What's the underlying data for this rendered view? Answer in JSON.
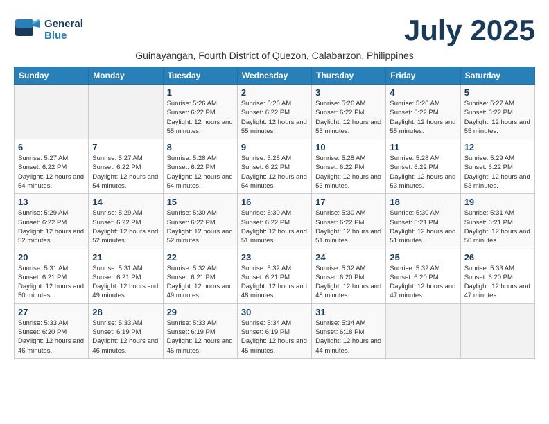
{
  "header": {
    "logo_line1": "General",
    "logo_line2": "Blue",
    "month_title": "July 2025",
    "subtitle": "Guinayangan, Fourth District of Quezon, Calabarzon, Philippines"
  },
  "weekdays": [
    "Sunday",
    "Monday",
    "Tuesday",
    "Wednesday",
    "Thursday",
    "Friday",
    "Saturday"
  ],
  "weeks": [
    [
      {
        "day": "",
        "info": ""
      },
      {
        "day": "",
        "info": ""
      },
      {
        "day": "1",
        "info": "Sunrise: 5:26 AM\nSunset: 6:22 PM\nDaylight: 12 hours and 55 minutes."
      },
      {
        "day": "2",
        "info": "Sunrise: 5:26 AM\nSunset: 6:22 PM\nDaylight: 12 hours and 55 minutes."
      },
      {
        "day": "3",
        "info": "Sunrise: 5:26 AM\nSunset: 6:22 PM\nDaylight: 12 hours and 55 minutes."
      },
      {
        "day": "4",
        "info": "Sunrise: 5:26 AM\nSunset: 6:22 PM\nDaylight: 12 hours and 55 minutes."
      },
      {
        "day": "5",
        "info": "Sunrise: 5:27 AM\nSunset: 6:22 PM\nDaylight: 12 hours and 55 minutes."
      }
    ],
    [
      {
        "day": "6",
        "info": "Sunrise: 5:27 AM\nSunset: 6:22 PM\nDaylight: 12 hours and 54 minutes."
      },
      {
        "day": "7",
        "info": "Sunrise: 5:27 AM\nSunset: 6:22 PM\nDaylight: 12 hours and 54 minutes."
      },
      {
        "day": "8",
        "info": "Sunrise: 5:28 AM\nSunset: 6:22 PM\nDaylight: 12 hours and 54 minutes."
      },
      {
        "day": "9",
        "info": "Sunrise: 5:28 AM\nSunset: 6:22 PM\nDaylight: 12 hours and 54 minutes."
      },
      {
        "day": "10",
        "info": "Sunrise: 5:28 AM\nSunset: 6:22 PM\nDaylight: 12 hours and 53 minutes."
      },
      {
        "day": "11",
        "info": "Sunrise: 5:28 AM\nSunset: 6:22 PM\nDaylight: 12 hours and 53 minutes."
      },
      {
        "day": "12",
        "info": "Sunrise: 5:29 AM\nSunset: 6:22 PM\nDaylight: 12 hours and 53 minutes."
      }
    ],
    [
      {
        "day": "13",
        "info": "Sunrise: 5:29 AM\nSunset: 6:22 PM\nDaylight: 12 hours and 52 minutes."
      },
      {
        "day": "14",
        "info": "Sunrise: 5:29 AM\nSunset: 6:22 PM\nDaylight: 12 hours and 52 minutes."
      },
      {
        "day": "15",
        "info": "Sunrise: 5:30 AM\nSunset: 6:22 PM\nDaylight: 12 hours and 52 minutes."
      },
      {
        "day": "16",
        "info": "Sunrise: 5:30 AM\nSunset: 6:22 PM\nDaylight: 12 hours and 51 minutes."
      },
      {
        "day": "17",
        "info": "Sunrise: 5:30 AM\nSunset: 6:22 PM\nDaylight: 12 hours and 51 minutes."
      },
      {
        "day": "18",
        "info": "Sunrise: 5:30 AM\nSunset: 6:21 PM\nDaylight: 12 hours and 51 minutes."
      },
      {
        "day": "19",
        "info": "Sunrise: 5:31 AM\nSunset: 6:21 PM\nDaylight: 12 hours and 50 minutes."
      }
    ],
    [
      {
        "day": "20",
        "info": "Sunrise: 5:31 AM\nSunset: 6:21 PM\nDaylight: 12 hours and 50 minutes."
      },
      {
        "day": "21",
        "info": "Sunrise: 5:31 AM\nSunset: 6:21 PM\nDaylight: 12 hours and 49 minutes."
      },
      {
        "day": "22",
        "info": "Sunrise: 5:32 AM\nSunset: 6:21 PM\nDaylight: 12 hours and 49 minutes."
      },
      {
        "day": "23",
        "info": "Sunrise: 5:32 AM\nSunset: 6:21 PM\nDaylight: 12 hours and 48 minutes."
      },
      {
        "day": "24",
        "info": "Sunrise: 5:32 AM\nSunset: 6:20 PM\nDaylight: 12 hours and 48 minutes."
      },
      {
        "day": "25",
        "info": "Sunrise: 5:32 AM\nSunset: 6:20 PM\nDaylight: 12 hours and 47 minutes."
      },
      {
        "day": "26",
        "info": "Sunrise: 5:33 AM\nSunset: 6:20 PM\nDaylight: 12 hours and 47 minutes."
      }
    ],
    [
      {
        "day": "27",
        "info": "Sunrise: 5:33 AM\nSunset: 6:20 PM\nDaylight: 12 hours and 46 minutes."
      },
      {
        "day": "28",
        "info": "Sunrise: 5:33 AM\nSunset: 6:19 PM\nDaylight: 12 hours and 46 minutes."
      },
      {
        "day": "29",
        "info": "Sunrise: 5:33 AM\nSunset: 6:19 PM\nDaylight: 12 hours and 45 minutes."
      },
      {
        "day": "30",
        "info": "Sunrise: 5:34 AM\nSunset: 6:19 PM\nDaylight: 12 hours and 45 minutes."
      },
      {
        "day": "31",
        "info": "Sunrise: 5:34 AM\nSunset: 6:18 PM\nDaylight: 12 hours and 44 minutes."
      },
      {
        "day": "",
        "info": ""
      },
      {
        "day": "",
        "info": ""
      }
    ]
  ]
}
